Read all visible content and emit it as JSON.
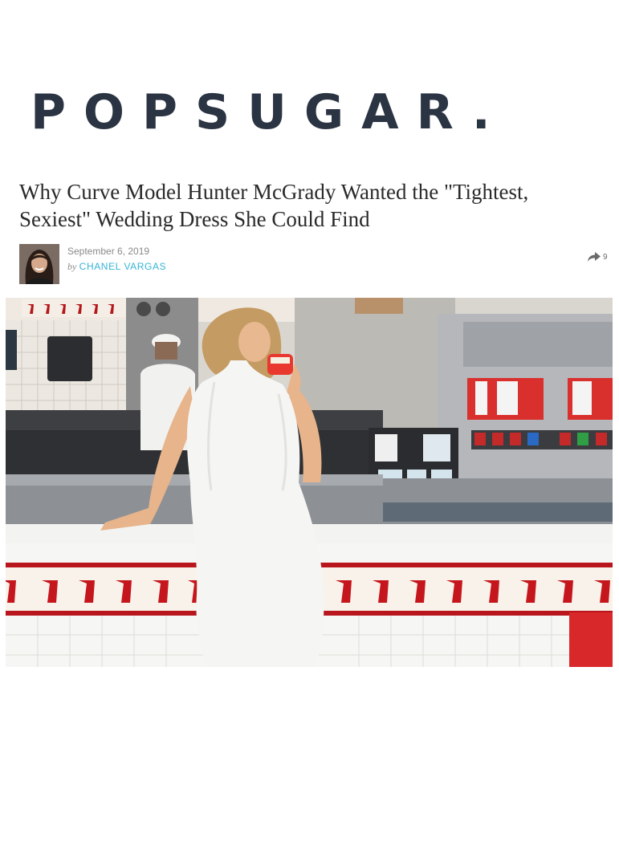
{
  "brand": {
    "logo_text": "POPSUGAR."
  },
  "article": {
    "title": "Why Curve Model Hunter McGrady Wanted the \"Tightest, Sexiest\" Wedding Dress She Could Find",
    "date": "September 6, 2019",
    "by": "by",
    "author": "CHANEL VARGAS",
    "share_count": "9"
  },
  "icons": {
    "share": "share-arrow-icon",
    "avatar": "author-avatar"
  },
  "colors": {
    "logo": "#2b3443",
    "author_link": "#35b4d6",
    "palm_red": "#c4161c"
  }
}
